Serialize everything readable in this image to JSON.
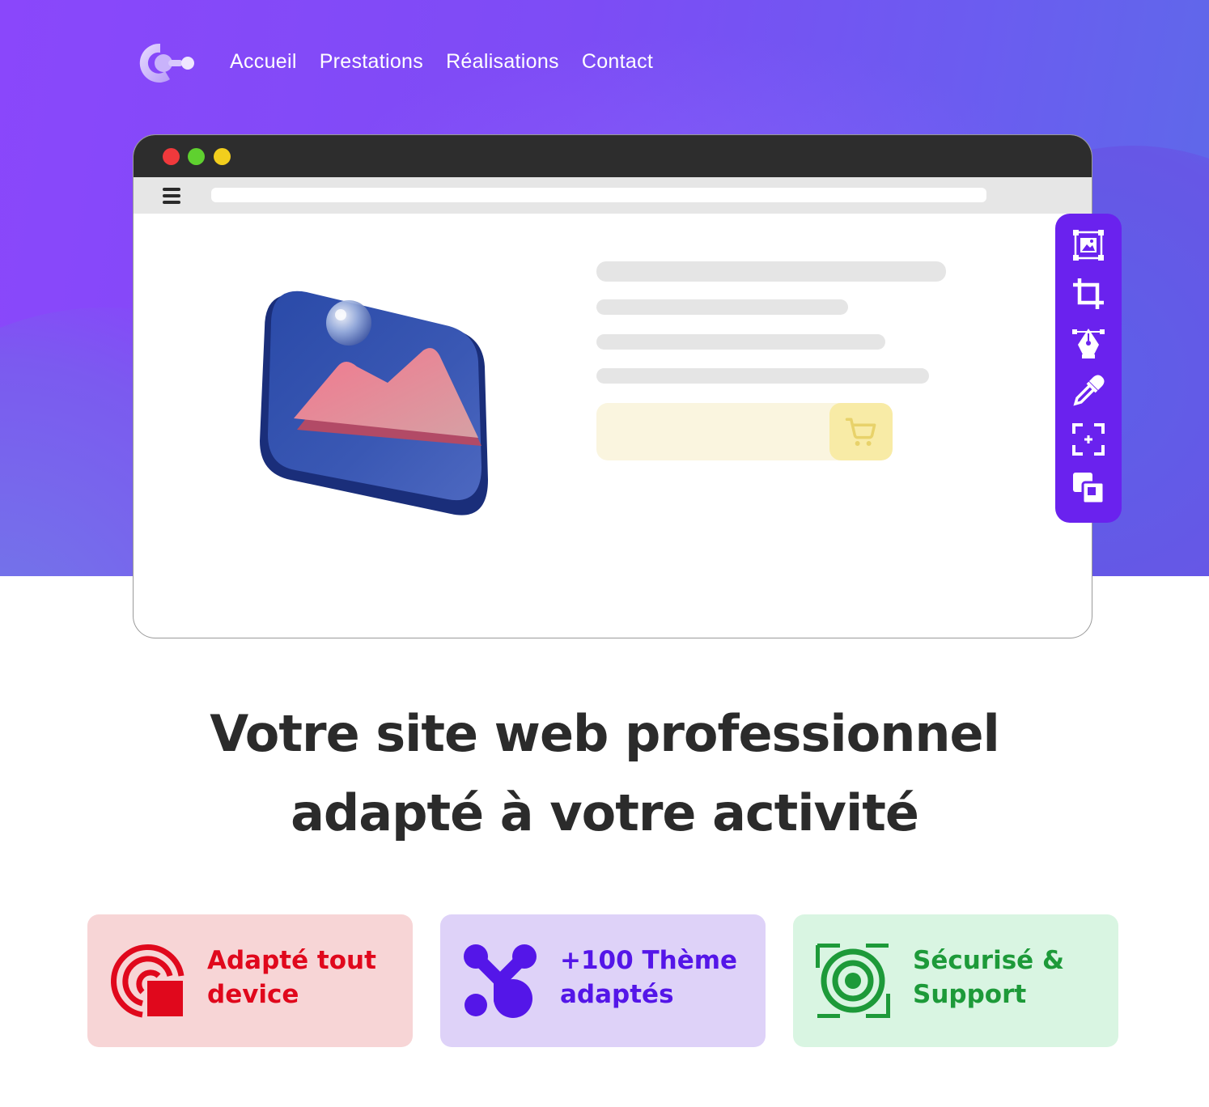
{
  "nav": {
    "items": [
      {
        "label": "Accueil"
      },
      {
        "label": "Prestations"
      },
      {
        "label": "Réalisations"
      },
      {
        "label": "Contact"
      }
    ]
  },
  "headline": {
    "line1": "Votre site web professionnel",
    "line2": "adapté à votre activité"
  },
  "features": [
    {
      "line1": "Adapté tout",
      "line2": "device",
      "icon": "responsive-device-icon",
      "color": "#e0081c"
    },
    {
      "line1": "+100 Thème",
      "line2": "adaptés",
      "icon": "themes-network-icon",
      "color": "#5416e8"
    },
    {
      "line1": "Sécurisé &",
      "line2": "Support",
      "icon": "security-target-icon",
      "color": "#1d9a39"
    }
  ],
  "toolbar": {
    "tools": [
      "image-select-icon",
      "crop-icon",
      "pen-tool-icon",
      "eyedropper-icon",
      "focus-add-icon",
      "layers-icon"
    ]
  },
  "colors": {
    "brand_purple": "#8a47fb",
    "toolbar": "#6a22ee"
  }
}
